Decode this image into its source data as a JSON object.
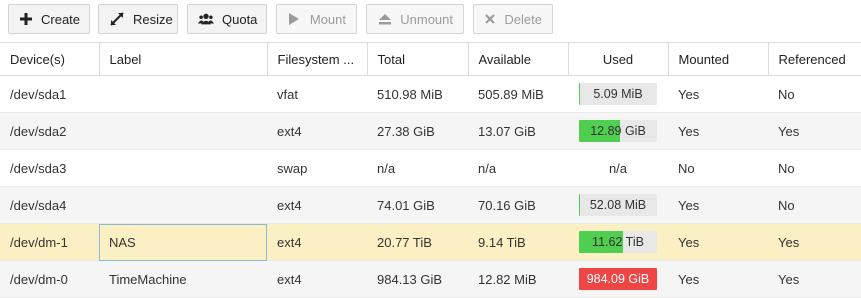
{
  "toolbar": {
    "create": "Create",
    "resize": "Resize",
    "quota": "Quota",
    "mount": "Mount",
    "unmount": "Unmount",
    "delete": "Delete"
  },
  "columns": {
    "device": "Device(s)",
    "label": "Label",
    "filesystem": "Filesystem ...",
    "total": "Total",
    "available": "Available",
    "used": "Used",
    "mounted": "Mounted",
    "referenced": "Referenced"
  },
  "rows": [
    {
      "device": "/dev/sda1",
      "label": "",
      "filesystem": "vfat",
      "total": "510.98 MiB",
      "available": "505.89 MiB",
      "used": "5.09 MiB",
      "used_fraction": 0.01,
      "mounted": "Yes",
      "referenced": "No"
    },
    {
      "device": "/dev/sda2",
      "label": "",
      "filesystem": "ext4",
      "total": "27.38 GiB",
      "available": "13.07 GiB",
      "used": "12.89 GiB",
      "used_fraction": 0.52,
      "mounted": "Yes",
      "referenced": "Yes"
    },
    {
      "device": "/dev/sda3",
      "label": "",
      "filesystem": "swap",
      "total": "n/a",
      "available": "n/a",
      "used": "n/a",
      "used_fraction": null,
      "mounted": "No",
      "referenced": "No"
    },
    {
      "device": "/dev/sda4",
      "label": "",
      "filesystem": "ext4",
      "total": "74.01 GiB",
      "available": "70.16 GiB",
      "used": "52.08 MiB",
      "used_fraction": 0.01,
      "mounted": "Yes",
      "referenced": "No"
    },
    {
      "device": "/dev/dm-1",
      "label": "NAS",
      "filesystem": "ext4",
      "total": "20.77 TiB",
      "available": "9.14 TiB",
      "used": "11.62 TiB",
      "used_fraction": 0.56,
      "mounted": "Yes",
      "referenced": "Yes"
    },
    {
      "device": "/dev/dm-0",
      "label": "TimeMachine",
      "filesystem": "ext4",
      "total": "984.13 GiB",
      "available": "12.82 MiB",
      "used": "984.09 GiB",
      "used_fraction": 1.0,
      "mounted": "Yes",
      "referenced": "Yes"
    }
  ],
  "selected_row": 4,
  "colors": {
    "bar_green": "#4fce4f",
    "bar_red": "#f04545",
    "bar_track": "#e8e8e8",
    "selected_row": "#fbefc4"
  }
}
